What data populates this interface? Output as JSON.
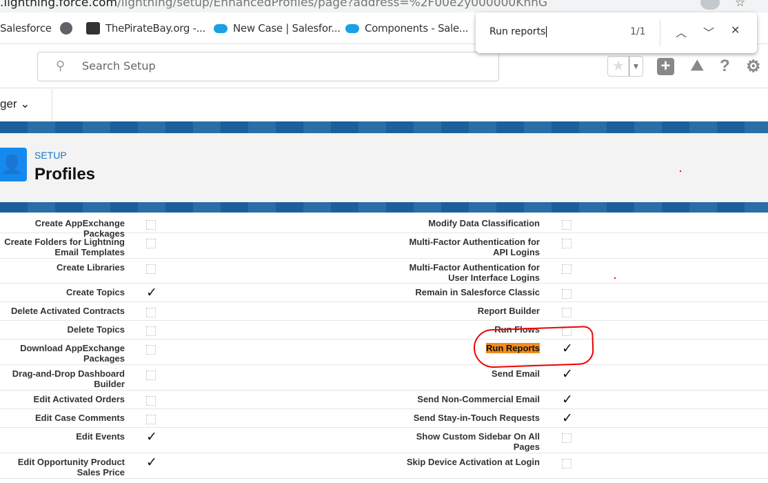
{
  "browser": {
    "url_host": ".lightning.force.com",
    "url_path": "/lightning/setup/EnhancedProfiles/page?address=%2F00e2y000000KhhG",
    "bookmarks": [
      {
        "label": "Salesforce",
        "icon": "none"
      },
      {
        "label": "",
        "icon": "globe-icon"
      },
      {
        "label": "ThePirateBay.org -...",
        "icon": "pirate-icon"
      },
      {
        "label": "New Case | Salesfor...",
        "icon": "cloud-icon"
      },
      {
        "label": "Components - Sale...",
        "icon": "cloud-icon"
      }
    ],
    "find_bar": {
      "query": "Run reports",
      "count": "1/1"
    }
  },
  "header": {
    "search_placeholder": "Search Setup"
  },
  "nav": {
    "app_label": "ger ⌄"
  },
  "page": {
    "breadcrumb": "SETUP",
    "title": "Profiles"
  },
  "permissions": [
    {
      "left": "Create AppExchange Packages",
      "left_checked": false,
      "right": "Modify Data Classification",
      "right_checked": false
    },
    {
      "left": "Create Folders for Lightning Email Templates",
      "left_checked": false,
      "right": "Multi-Factor Authentication for API Logins",
      "right_checked": false
    },
    {
      "left": "Create Libraries",
      "left_checked": false,
      "right": "Multi-Factor Authentication for User Interface Logins",
      "right_checked": false
    },
    {
      "left": "Create Topics",
      "left_checked": true,
      "right": "Remain in Salesforce Classic",
      "right_checked": false
    },
    {
      "left": "Delete Activated Contracts",
      "left_checked": false,
      "right": "Report Builder",
      "right_checked": false
    },
    {
      "left": "Delete Topics",
      "left_checked": false,
      "right": "Run Flows",
      "right_checked": false
    },
    {
      "left": "Download AppExchange Packages",
      "left_checked": false,
      "right": "Run Reports",
      "right_checked": true,
      "right_highlighted": true
    },
    {
      "left": "Drag-and-Drop Dashboard Builder",
      "left_checked": false,
      "right": "Send Email",
      "right_checked": true
    },
    {
      "left": "Edit Activated Orders",
      "left_checked": false,
      "right": "Send Non-Commercial Email",
      "right_checked": true
    },
    {
      "left": "Edit Case Comments",
      "left_checked": false,
      "right": "Send Stay-in-Touch Requests",
      "right_checked": true
    },
    {
      "left": "Edit Events",
      "left_checked": true,
      "right": "Show Custom Sidebar On All Pages",
      "right_checked": false
    },
    {
      "left": "Edit Opportunity Product Sales Price",
      "left_checked": true,
      "right": "Skip Device Activation at Login",
      "right_checked": false
    }
  ],
  "colors": {
    "highlight": "#f28c1b",
    "brand_blue": "#1589ee",
    "annotation": "#e00000"
  }
}
